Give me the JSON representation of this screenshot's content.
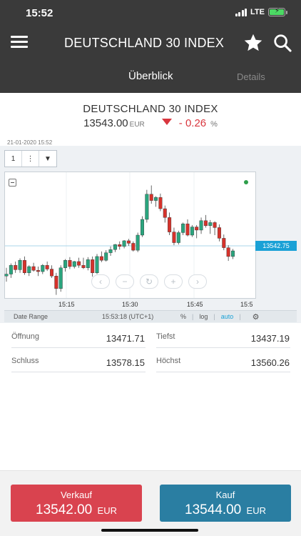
{
  "status": {
    "time": "15:52",
    "network": "LTE"
  },
  "header": {
    "title": "DEUTSCHLAND 30 INDEX"
  },
  "tabs": [
    {
      "label": "Überblick",
      "active": true
    },
    {
      "label": "Details",
      "active": false
    }
  ],
  "instrument": {
    "name": "DEUTSCHLAND 30 INDEX",
    "price": "13543.00",
    "currency": "EUR",
    "change": "- 0.26",
    "change_unit": "%",
    "direction": "down"
  },
  "chart": {
    "date": "21-01-2020 15:52",
    "period_value": "1",
    "last_price": "13542.75",
    "footer": {
      "date_range": "Date Range",
      "time": "15:53:18 (UTC+1)",
      "percent": "%",
      "log": "log",
      "auto": "auto"
    }
  },
  "chart_data": {
    "type": "candlestick",
    "x_ticks": [
      "15:15",
      "15:30",
      "15:45",
      "15:5"
    ],
    "x_start": "15:04",
    "interval_minutes": 1,
    "ylim": [
      13420,
      13620
    ],
    "colors": {
      "up": "#2aa57e",
      "down": "#d6322b"
    },
    "candles": [
      [
        13455,
        13468,
        13446,
        13458
      ],
      [
        13458,
        13475,
        13452,
        13472
      ],
      [
        13472,
        13478,
        13460,
        13465
      ],
      [
        13465,
        13483,
        13460,
        13480
      ],
      [
        13480,
        13486,
        13457,
        13460
      ],
      [
        13460,
        13472,
        13455,
        13470
      ],
      [
        13470,
        13476,
        13462,
        13464
      ],
      [
        13464,
        13470,
        13455,
        13462
      ],
      [
        13462,
        13474,
        13458,
        13472
      ],
      [
        13472,
        13478,
        13463,
        13466
      ],
      [
        13466,
        13472,
        13452,
        13455
      ],
      [
        13455,
        13460,
        13425,
        13435
      ],
      [
        13435,
        13472,
        13430,
        13468
      ],
      [
        13468,
        13482,
        13462,
        13480
      ],
      [
        13480,
        13485,
        13466,
        13470
      ],
      [
        13470,
        13479,
        13467,
        13478
      ],
      [
        13478,
        13484,
        13468,
        13472
      ],
      [
        13472,
        13484,
        13466,
        13468
      ],
      [
        13468,
        13485,
        13464,
        13481
      ],
      [
        13481,
        13486,
        13454,
        13460
      ],
      [
        13460,
        13490,
        13458,
        13486
      ],
      [
        13486,
        13494,
        13477,
        13480
      ],
      [
        13480,
        13496,
        13478,
        13492
      ],
      [
        13492,
        13502,
        13487,
        13497
      ],
      [
        13497,
        13506,
        13493,
        13505
      ],
      [
        13505,
        13510,
        13497,
        13502
      ],
      [
        13502,
        13512,
        13499,
        13511
      ],
      [
        13511,
        13514,
        13503,
        13507
      ],
      [
        13507,
        13510,
        13494,
        13496
      ],
      [
        13496,
        13524,
        13493,
        13520
      ],
      [
        13520,
        13550,
        13517,
        13545
      ],
      [
        13545,
        13592,
        13540,
        13585
      ],
      [
        13585,
        13599,
        13570,
        13575
      ],
      [
        13575,
        13582,
        13565,
        13580
      ],
      [
        13580,
        13586,
        13558,
        13562
      ],
      [
        13562,
        13567,
        13540,
        13548
      ],
      [
        13548,
        13556,
        13520,
        13525
      ],
      [
        13525,
        13532,
        13504,
        13508
      ],
      [
        13508,
        13527,
        13505,
        13524
      ],
      [
        13524,
        13540,
        13520,
        13538
      ],
      [
        13538,
        13545,
        13518,
        13520
      ],
      [
        13520,
        13536,
        13517,
        13533
      ],
      [
        13533,
        13536,
        13515,
        13528
      ],
      [
        13528,
        13548,
        13522,
        13543
      ],
      [
        13543,
        13552,
        13532,
        13535
      ],
      [
        13535,
        13544,
        13522,
        13540
      ],
      [
        13540,
        13542,
        13520,
        13532
      ],
      [
        13532,
        13537,
        13510,
        13515
      ],
      [
        13515,
        13521,
        13496,
        13500
      ],
      [
        13500,
        13504,
        13479,
        13486
      ],
      [
        13486,
        13498,
        13482,
        13495
      ]
    ]
  },
  "stats": [
    {
      "label": "Öffnung",
      "value": "13471.71"
    },
    {
      "label": "Tiefst",
      "value": "13437.19"
    },
    {
      "label": "Schluss",
      "value": "13578.15"
    },
    {
      "label": "Höchst",
      "value": "13560.26"
    }
  ],
  "trade": {
    "sell": {
      "label": "Verkauf",
      "price": "13542.00",
      "currency": "EUR"
    },
    "buy": {
      "label": "Kauf",
      "price": "13544.00",
      "currency": "EUR"
    }
  },
  "icons": {
    "menu": "hamburger-icon",
    "favorite": "star-icon",
    "search": "search-icon",
    "settings": "gear-icon"
  }
}
